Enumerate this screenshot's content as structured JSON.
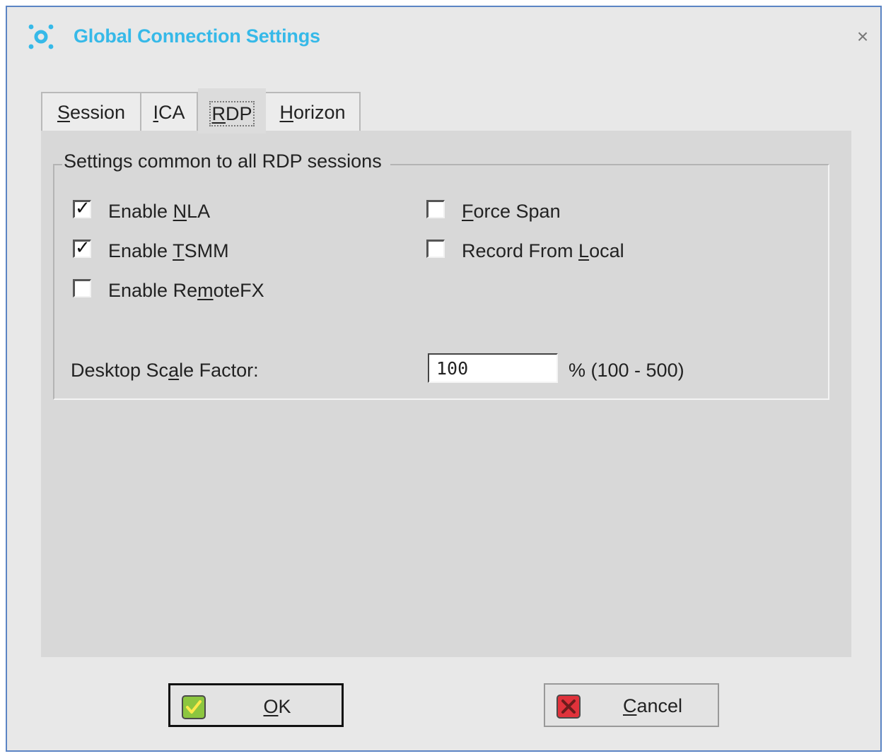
{
  "window": {
    "title": "Global Connection Settings",
    "close_glyph": "×"
  },
  "tabs": [
    {
      "label": "Session",
      "mnemonic": "S",
      "rest": "ession",
      "active": false
    },
    {
      "label": "ICA",
      "mnemonic": "I",
      "rest": "CA",
      "active": false
    },
    {
      "label": "RDP",
      "mnemonic": "R",
      "rest": "DP",
      "active": true
    },
    {
      "label": "Horizon",
      "mnemonic": "H",
      "rest": "orizon",
      "active": false
    }
  ],
  "group": {
    "title": "Settings common to all RDP sessions"
  },
  "checkboxes": {
    "enable_nla": {
      "pre": "Enable ",
      "mnemonic": "N",
      "post": "LA",
      "checked": true,
      "tick": "✓"
    },
    "enable_tsmm": {
      "pre": "Enable ",
      "mnemonic": "T",
      "post": "SMM",
      "checked": true,
      "tick": "✓"
    },
    "enable_remotefx": {
      "pre": "Enable Re",
      "mnemonic": "m",
      "post": "oteFX",
      "checked": false,
      "tick": ""
    },
    "force_span": {
      "pre": "",
      "mnemonic": "F",
      "post": "orce Span",
      "checked": false,
      "tick": ""
    },
    "record_from_local": {
      "pre": "Record From ",
      "mnemonic": "L",
      "post": "ocal",
      "checked": false,
      "tick": ""
    }
  },
  "desktop_scale": {
    "label_pre": "Desktop Sc",
    "label_mnemonic": "a",
    "label_post": "le Factor:",
    "value": "100",
    "unit": "% (100 - 500)"
  },
  "buttons": {
    "ok": {
      "mnemonic": "O",
      "rest": "K",
      "icon": "green-check-icon",
      "color": "#8cc63f"
    },
    "cancel": {
      "mnemonic": "C",
      "rest": "ancel",
      "icon": "red-x-icon",
      "color": "#e0323b"
    }
  },
  "colors": {
    "title": "#36b9e8",
    "window_border": "#5b84c4"
  }
}
